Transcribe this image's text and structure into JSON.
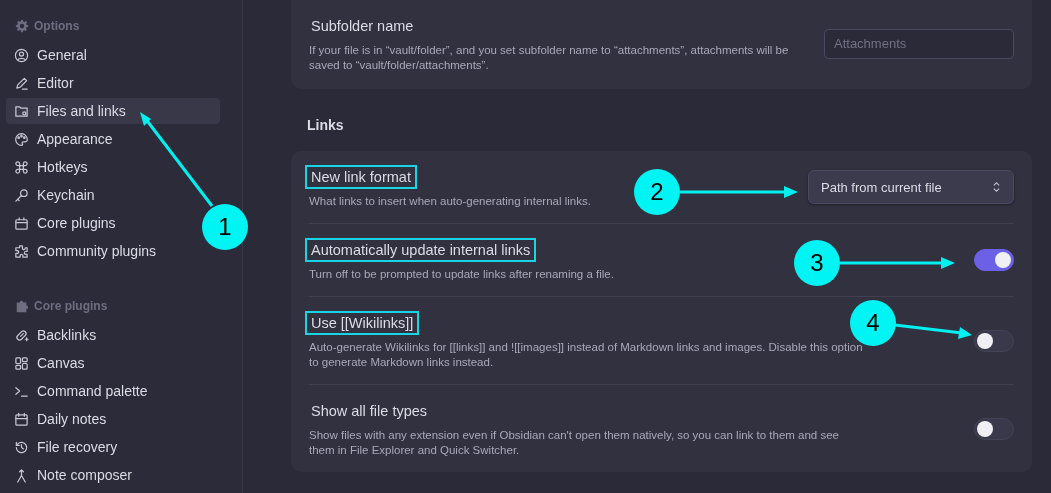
{
  "sidebar": {
    "sections": [
      {
        "heading": "Options",
        "items": [
          {
            "label": "General",
            "selected": false
          },
          {
            "label": "Editor",
            "selected": false
          },
          {
            "label": "Files and links",
            "selected": true
          },
          {
            "label": "Appearance",
            "selected": false
          },
          {
            "label": "Hotkeys",
            "selected": false
          },
          {
            "label": "Keychain",
            "selected": false
          },
          {
            "label": "Core plugins",
            "selected": false
          },
          {
            "label": "Community plugins",
            "selected": false
          }
        ]
      },
      {
        "heading": "Core plugins",
        "items": [
          {
            "label": "Backlinks",
            "selected": false
          },
          {
            "label": "Canvas",
            "selected": false
          },
          {
            "label": "Command palette",
            "selected": false
          },
          {
            "label": "Daily notes",
            "selected": false
          },
          {
            "label": "File recovery",
            "selected": false
          },
          {
            "label": "Note composer",
            "selected": false
          }
        ]
      }
    ]
  },
  "attachments_card": {
    "settings": [
      {
        "kind": "text",
        "name": "Subfolder name",
        "description": "If your file is in “vault/folder”, and you set subfolder name to “attachments”, attachments will be saved to “vault/folder/attachments”.",
        "placeholder": "Attachments",
        "highlighted": false
      }
    ]
  },
  "links": {
    "heading": "Links",
    "settings": [
      {
        "kind": "dropdown",
        "name": "New link format",
        "description": "What links to insert when auto-generating internal links.",
        "value": "Path from current file",
        "highlighted": true
      },
      {
        "kind": "toggle",
        "name": "Automatically update internal links",
        "description": "Turn off to be prompted to update links after renaming a file.",
        "on": true,
        "highlighted": true
      },
      {
        "kind": "toggle",
        "name": "Use [[Wikilinks]]",
        "description": "Auto-generate Wikilinks for [[links]] and ![[images]] instead of Markdown links and images. Disable this option to generate Markdown links instead.",
        "on": false,
        "highlighted": true
      },
      {
        "kind": "toggle",
        "name": "Show all file types",
        "description": "Show files with any extension even if Obsidian can't open them natively, so you can link to them and see them in File Explorer and Quick Switcher.",
        "on": false,
        "highlighted": false
      }
    ]
  },
  "callouts": [
    {
      "label": "1"
    },
    {
      "label": "2"
    },
    {
      "label": "3"
    },
    {
      "label": "4"
    }
  ]
}
